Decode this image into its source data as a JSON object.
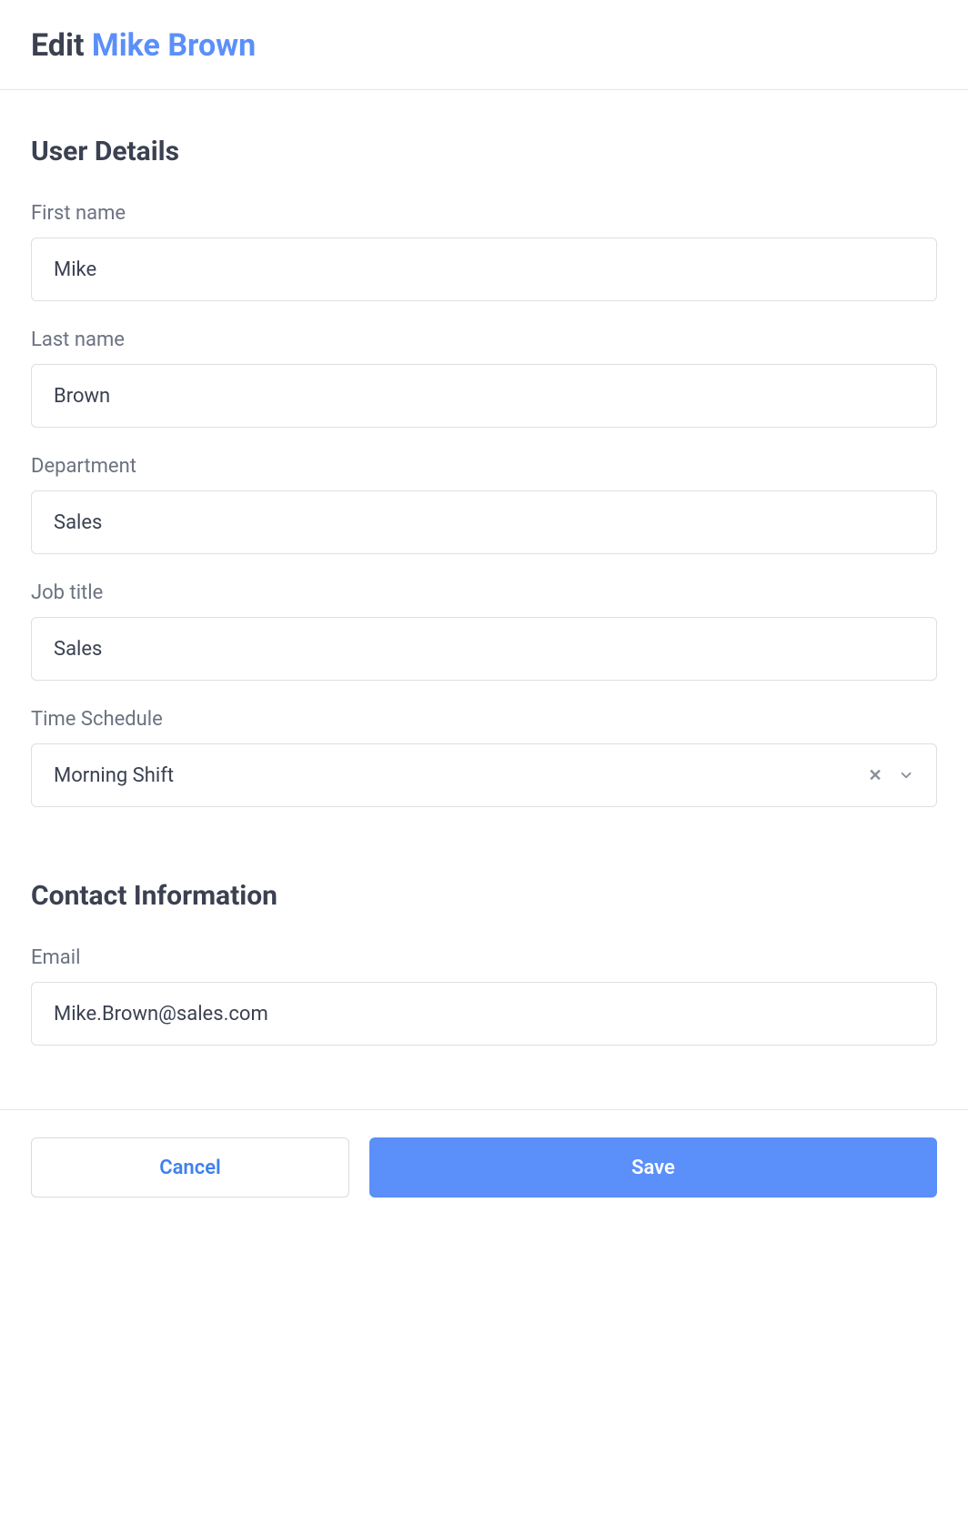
{
  "header": {
    "prefix": "Edit",
    "user_name": "Mike Brown"
  },
  "sections": {
    "user_details_title": "User Details",
    "contact_info_title": "Contact Information"
  },
  "fields": {
    "first_name": {
      "label": "First name",
      "value": "Mike"
    },
    "last_name": {
      "label": "Last name",
      "value": "Brown"
    },
    "department": {
      "label": "Department",
      "value": "Sales"
    },
    "job_title": {
      "label": "Job title",
      "value": "Sales"
    },
    "time_schedule": {
      "label": "Time Schedule",
      "value": "Morning Shift"
    },
    "email": {
      "label": "Email",
      "value": "Mike.Brown@sales.com"
    }
  },
  "buttons": {
    "cancel": "Cancel",
    "save": "Save"
  }
}
